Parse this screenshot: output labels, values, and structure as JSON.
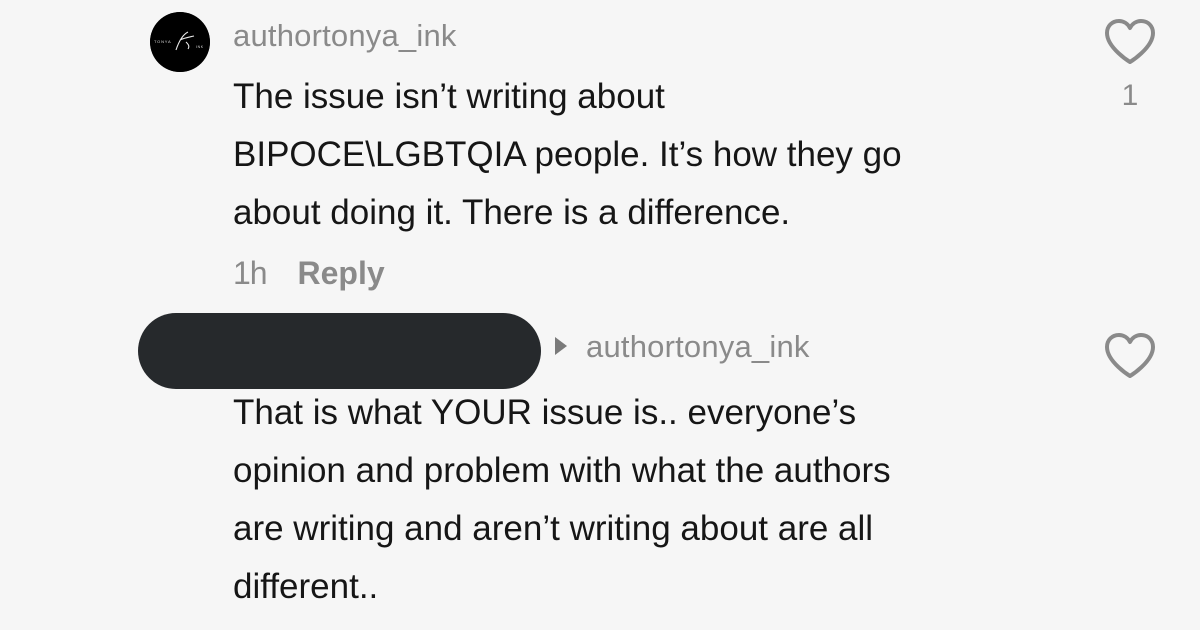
{
  "comments": [
    {
      "username": "authortonya_ink",
      "text_lines": [
        "The issue isn’t writing about",
        "BIPOCE\\LGBTQIA people. It’s how they go",
        "about doing it. There is a difference."
      ],
      "time": "1h",
      "reply_label": "Reply",
      "like_count": "1",
      "avatar_icon": "tonya-ink-logo"
    },
    {
      "reply_to": "authortonya_ink",
      "text_lines": [
        "That is what YOUR issue is.. everyone’s",
        "opinion and problem with what the authors",
        "are writing and aren’t writing about are all",
        "different.."
      ],
      "like_count": ""
    }
  ],
  "colors": {
    "background": "#f6f6f6",
    "text": "#161616",
    "muted": "#8a8a8a",
    "redaction": "#26292c"
  }
}
